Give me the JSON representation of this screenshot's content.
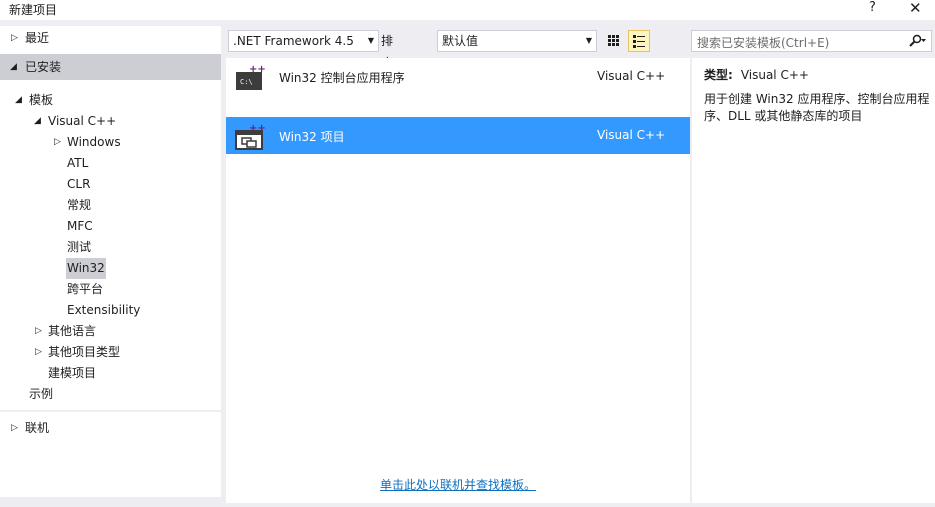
{
  "window": {
    "title": "新建项目",
    "help": "?",
    "close": "✕"
  },
  "nav": {
    "recent": "最近",
    "installed": "已安装",
    "templates": "模板",
    "visual_cpp": "Visual C++",
    "windows": "Windows",
    "atl": "ATL",
    "clr": "CLR",
    "general": "常规",
    "mfc": "MFC",
    "test": "测试",
    "win32": "Win32",
    "cross_platform": "跨平台",
    "extensibility": "Extensibility",
    "other_languages": "其他语言",
    "other_project_types": "其他项目类型",
    "modeling_projects": "建模项目",
    "samples": "示例",
    "online": "联机"
  },
  "toolbar": {
    "framework": ".NET Framework 4.5",
    "sort_label": "排序依据:",
    "sort_value": "默认值"
  },
  "search": {
    "placeholder": "搜索已安装模板(Ctrl+E)"
  },
  "templates": [
    {
      "name": "Win32 控制台应用程序",
      "lang": "Visual C++",
      "selected": false
    },
    {
      "name": "Win32 项目",
      "lang": "Visual C++",
      "selected": true
    }
  ],
  "online_link": "单击此处以联机并查找模板。",
  "details": {
    "type_label": "类型:",
    "type_value": "Visual C++",
    "description": "用于创建 Win32 应用程序、控制台应用程序、DLL 或其他静态库的项目"
  },
  "colors": {
    "selection": "#3399ff",
    "nav_selected": "#ccced3",
    "link": "#0e70c0"
  }
}
